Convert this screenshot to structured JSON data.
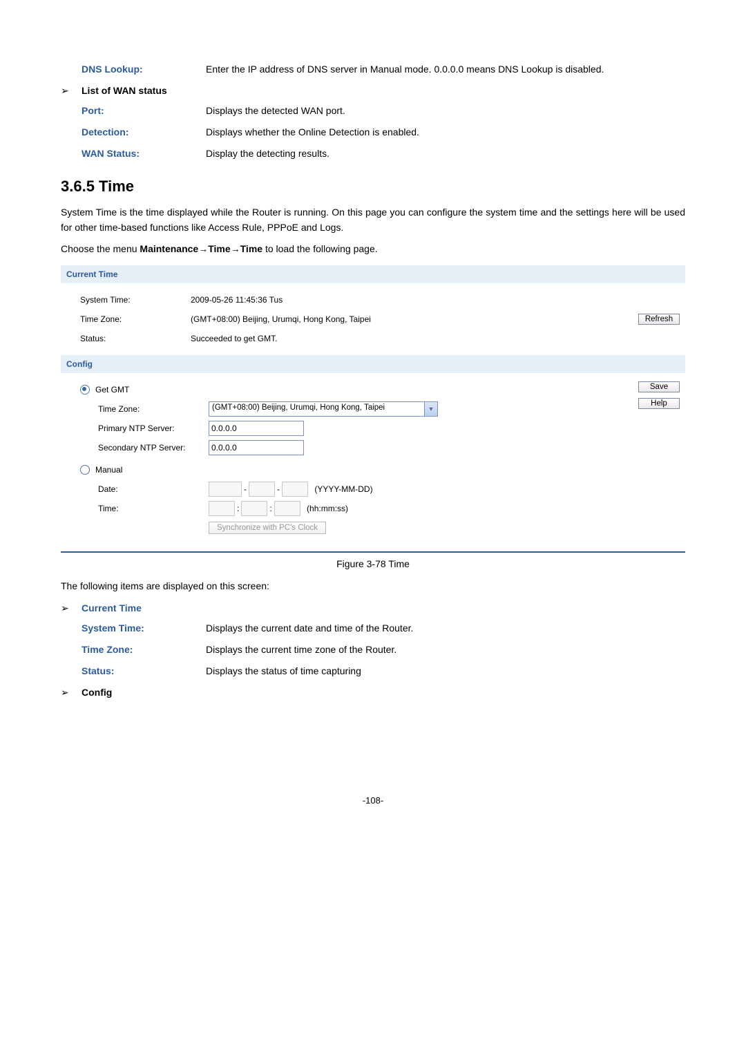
{
  "defs1": {
    "dns_lookup_label": "DNS Lookup:",
    "dns_lookup_desc": "Enter the IP address of DNS server in Manual mode. 0.0.0.0 means DNS Lookup is disabled."
  },
  "bullet_wan": "List of WAN status",
  "defs2": {
    "port_label": "Port:",
    "port_desc": "Displays the detected WAN port.",
    "detection_label": "Detection:",
    "detection_desc": "Displays whether the Online Detection is enabled.",
    "wan_status_label": "WAN Status:",
    "wan_status_desc": "Display the detecting results."
  },
  "section_title": "3.6.5   Time",
  "para1": "System Time is the time displayed while the Router is running. On this page you can configure the system time and the settings here will be used for other time-based functions like Access Rule, PPPoE and Logs.",
  "para2_prefix": "Choose the menu ",
  "para2_path": "Maintenance→Time→Time",
  "para2_suffix": " to load the following page.",
  "figure": {
    "panel1_title": "Current Time",
    "system_time_label": "System Time:",
    "system_time_value": "2009-05-26 11:45:36 Tus",
    "time_zone_label": "Time Zone:",
    "time_zone_value": "(GMT+08:00) Beijing, Urumqi, Hong Kong, Taipei",
    "status_label": "Status:",
    "status_value": "Succeeded to get GMT.",
    "refresh_btn": "Refresh",
    "panel2_title": "Config",
    "radio_getgmt": "Get GMT",
    "cfg_tz_label": "Time Zone:",
    "cfg_tz_value": "(GMT+08:00) Beijing, Urumqi, Hong Kong, Taipei",
    "primary_ntp_label": "Primary NTP Server:",
    "primary_ntp_value": "0.0.0.0",
    "secondary_ntp_label": "Secondary NTP Server:",
    "secondary_ntp_value": "0.0.0.0",
    "radio_manual": "Manual",
    "date_label": "Date:",
    "date_hint": "(YYYY-MM-DD)",
    "time_label": "Time:",
    "time_hint": "(hh:mm:ss)",
    "sync_btn": "Synchronize with PC's Clock",
    "save_btn": "Save",
    "help_btn": "Help"
  },
  "figure_caption": "Figure 3-78 Time",
  "para3": "The following items are displayed on this screen:",
  "bullet_current_time": "Current Time",
  "defs3": {
    "system_time_label": "System Time:",
    "system_time_desc": "Displays the current date and time of the Router.",
    "time_zone_label": "Time Zone:",
    "time_zone_desc": "Displays the current time zone of the Router.",
    "status_label": "Status:",
    "status_desc": "Displays the status of time capturing"
  },
  "bullet_config": "Config",
  "page_number": "-108-"
}
